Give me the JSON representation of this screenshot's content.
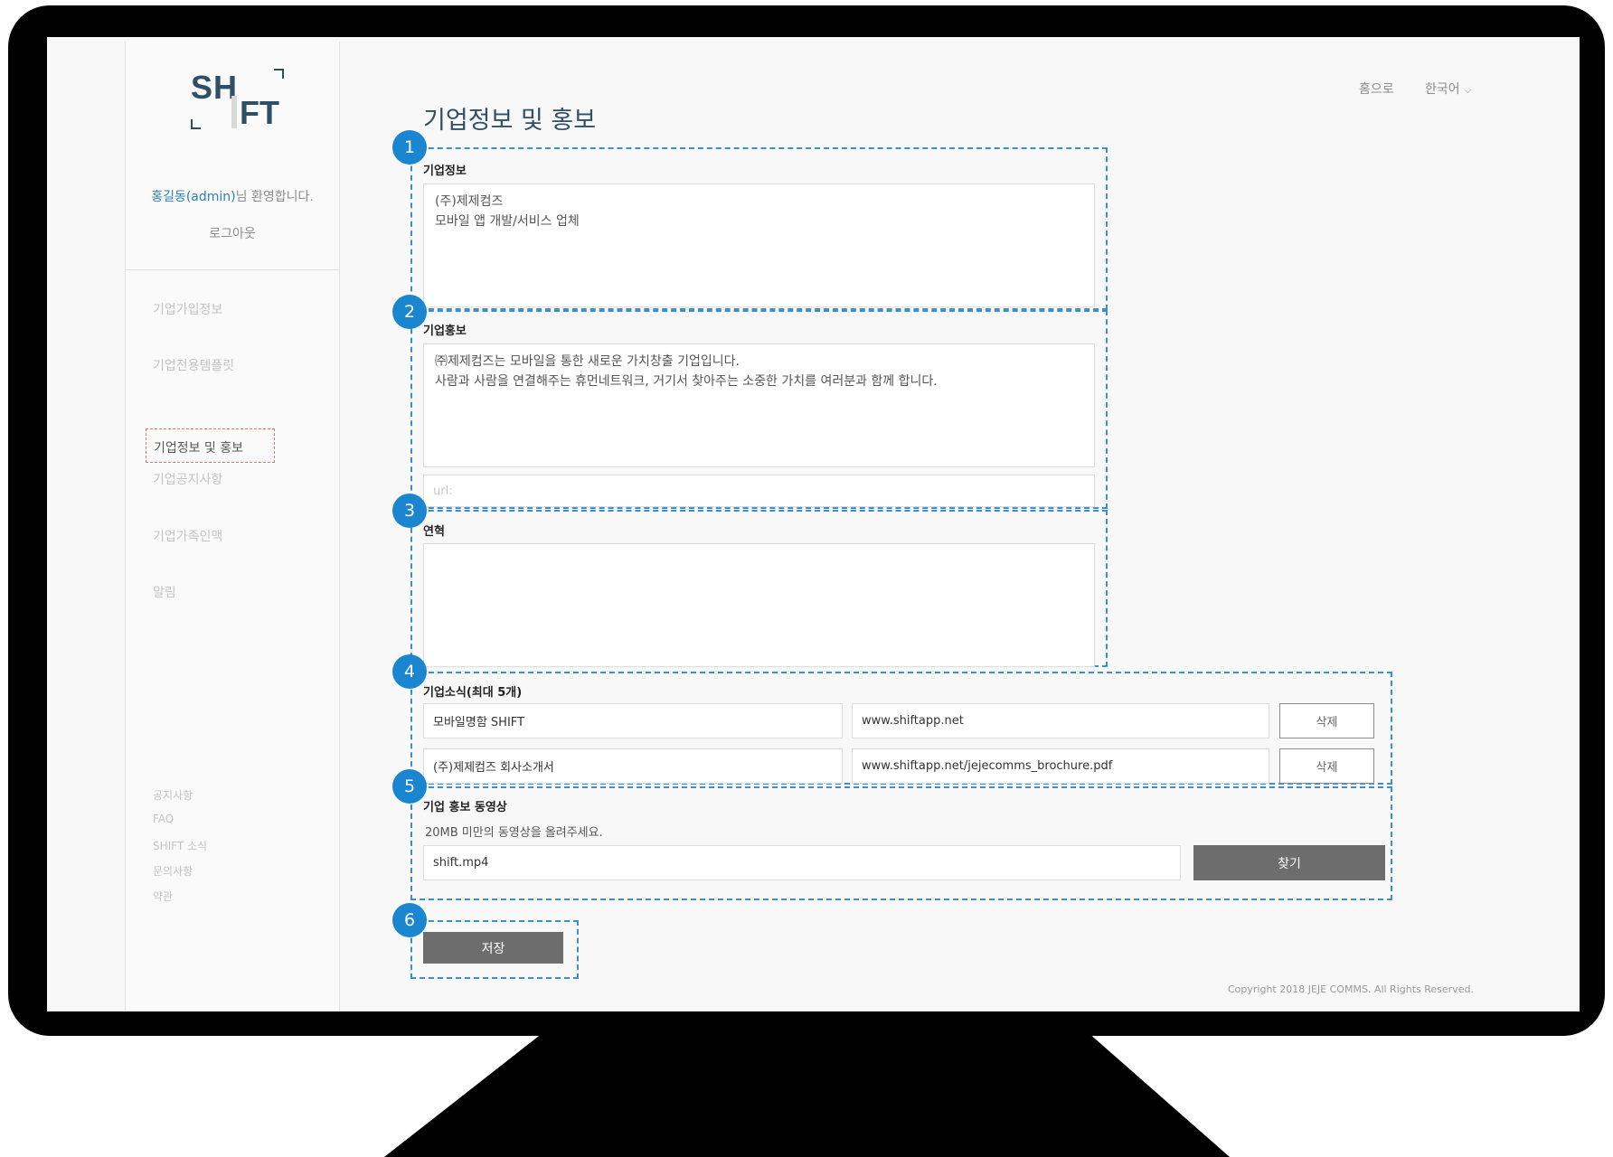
{
  "sidebar": {
    "logo_top": "SH",
    "logo_bottom": "FT",
    "welcome_name": "홍길동(admin)",
    "welcome_suffix": "님 환영합니다.",
    "logout": "로그아웃",
    "nav": [
      "기업가입정보",
      "기업전용템플릿",
      "기업정보 및 홍보",
      "기업공지사항",
      "기업가족인맥",
      "알림"
    ],
    "footer": [
      "공지사항",
      "FAQ",
      "SHIFT 소식",
      "문의사항",
      "약관"
    ]
  },
  "top": {
    "home": "홈으로",
    "lang": "한국어",
    "lang_icon": "chevron-down-icon"
  },
  "page_title": "기업정보 및 홍보",
  "sections": {
    "info": {
      "badge": "1",
      "label": "기업정보",
      "line1": "(주)제제컴즈",
      "line2": "모바일 앱 개발/서비스 업체"
    },
    "promo": {
      "badge": "2",
      "label": "기업홍보",
      "line1": "㈜제제컴즈는 모바일을 통한 새로운 가치창출 기업입니다.",
      "line2": "사람과 사람을 연결해주는 휴먼네트워크, 거기서 찾아주는 소중한 가치를 여러분과 함께 합니다.",
      "url_placeholder": "url:"
    },
    "history": {
      "badge": "3",
      "label": "연혁"
    },
    "news": {
      "badge": "4",
      "label": "기업소식(최대 5개)",
      "rows": [
        {
          "title": "모바일명함 SHIFT",
          "url": "www.shiftapp.net",
          "delete": "삭제"
        },
        {
          "title": "(주)제제컴즈 회사소개서",
          "url": "www.shiftapp.net/jejecomms_brochure.pdf",
          "delete": "삭제"
        }
      ]
    },
    "video": {
      "badge": "5",
      "label": "기업 홍보 동영상",
      "hint": "20MB 미만의 동영상을 올려주세요.",
      "file": "shift.mp4",
      "find": "찾기"
    },
    "save": {
      "badge": "6",
      "label": "저장"
    }
  },
  "copyright": "Copyright 2018 JEJE COMMS. All Rights Reserved.",
  "colors": {
    "accent": "#1a86d0",
    "dashed": "#3a8fd0",
    "brand": "#2f4f66",
    "button": "#6d6d6d"
  }
}
